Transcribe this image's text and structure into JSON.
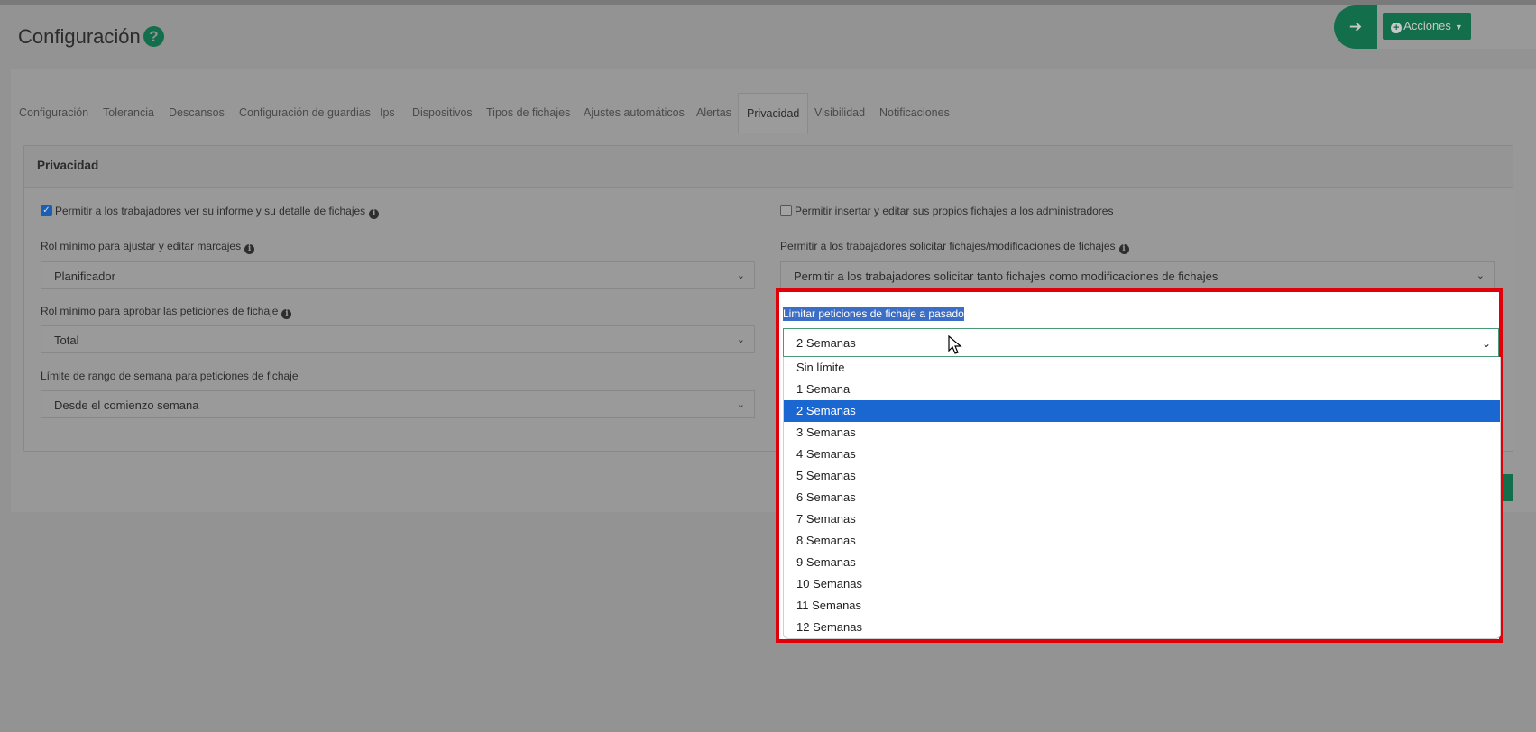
{
  "header": {
    "title": "Configuración",
    "help_icon": "question-circle-icon",
    "actions_label": "Acciones",
    "arrow_icon": "arrow-right-icon"
  },
  "tabs": [
    {
      "label": "Configuración"
    },
    {
      "label": "Tolerancia"
    },
    {
      "label": "Descansos"
    },
    {
      "label": "Configuración de guardias"
    },
    {
      "label": "Ips"
    },
    {
      "label": "Dispositivos"
    },
    {
      "label": "Tipos de fichajes"
    },
    {
      "label": "Ajustes automáticos"
    },
    {
      "label": "Alertas"
    },
    {
      "label": "Privacidad",
      "active": true
    },
    {
      "label": "Visibilidad"
    },
    {
      "label": "Notificaciones"
    }
  ],
  "card": {
    "title": "Privacidad",
    "left": {
      "checkbox_label": "Permitir a los trabajadores ver su informe y su detalle de fichajes",
      "checkbox_checked": true,
      "min_role_edit_label": "Rol mínimo para ajustar y editar marcajes",
      "min_role_edit_value": "Planificador",
      "min_role_approve_label": "Rol mínimo para aprobar las peticiones de fichaje",
      "min_role_approve_value": "Total",
      "week_range_label": "Límite de rango de semana para peticiones de fichaje",
      "week_range_value": "Desde el comienzo semana"
    },
    "right": {
      "checkbox_label": "Permitir insertar y editar sus propios fichajes a los administradores",
      "checkbox_checked": false,
      "request_label": "Permitir a los trabajadores solicitar fichajes/modificaciones de fichajes",
      "request_value": "Permitir a los trabajadores solicitar tanto fichajes como modificaciones de fichajes",
      "limit_label": "Limitar peticiones de fichaje a pasado",
      "limit_value": "2 Semanas",
      "limit_options": [
        "Sin límite",
        "1 Semana",
        "2 Semanas",
        "3 Semanas",
        "4 Semanas",
        "5 Semanas",
        "6 Semanas",
        "7 Semanas",
        "8 Semanas",
        "9 Semanas",
        "10 Semanas",
        "11 Semanas",
        "12 Semanas"
      ],
      "limit_selected_index": 2
    }
  },
  "colors": {
    "brand_green": "#136e4c",
    "highlight_red": "#e0000a",
    "selection_blue": "#1a67d2"
  }
}
